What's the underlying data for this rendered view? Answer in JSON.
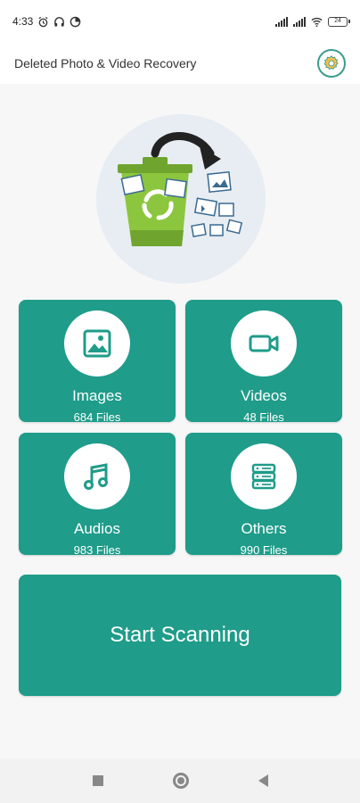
{
  "status_bar": {
    "time": "4:33",
    "battery": "24"
  },
  "app": {
    "title": "Deleted Photo & Video Recovery"
  },
  "categories": [
    {
      "label": "Images",
      "count": "684  Files",
      "icon": "image-icon"
    },
    {
      "label": "Videos",
      "count": "48  Files",
      "icon": "video-camera-icon"
    },
    {
      "label": "Audios",
      "count": "983  Files",
      "icon": "music-note-icon"
    },
    {
      "label": "Others",
      "count": "990  Files",
      "icon": "storage-icon"
    }
  ],
  "scan_button": {
    "label": "Start Scanning"
  },
  "colors": {
    "primary": "#1f9c8a",
    "background": "#f7f7f7",
    "hero_circle": "#e7edf2",
    "bin_green": "#8cc63f"
  }
}
